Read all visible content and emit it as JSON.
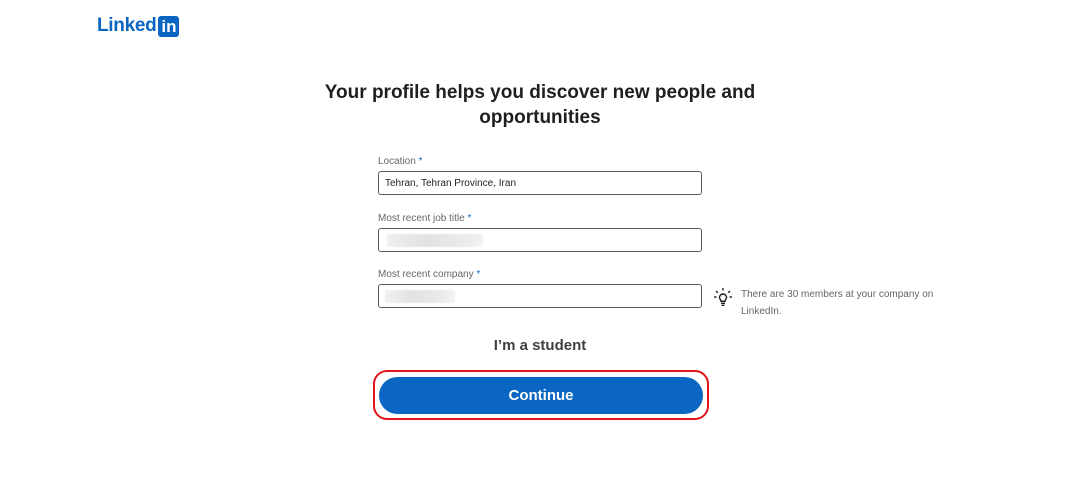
{
  "logo": {
    "text": "Linked",
    "box_text": "in",
    "brand_color": "#0a66c2"
  },
  "heading": {
    "line1": "Your profile helps you discover new people and",
    "line2": "opportunities"
  },
  "form": {
    "location": {
      "label": "Location",
      "required_mark": "*",
      "value": "Tehran, Tehran Province, Iran"
    },
    "job_title": {
      "label": "Most recent job title",
      "required_mark": "*",
      "value_redacted": true
    },
    "company": {
      "label": "Most recent company",
      "required_mark": "*",
      "value_redacted": true
    }
  },
  "hint": {
    "icon": "lightbulb-icon",
    "text": "There are 30 members at your company on LinkedIn."
  },
  "student_link": "I’m a student",
  "continue_button": {
    "label": "Continue",
    "highlight_color": "#e0151a"
  }
}
